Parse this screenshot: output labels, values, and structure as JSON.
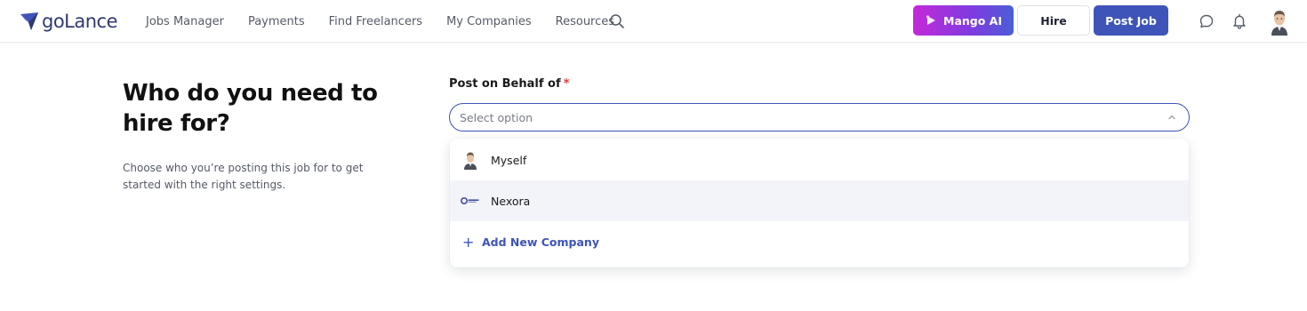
{
  "header": {
    "brand": "goLance",
    "nav": [
      {
        "label": "Jobs Manager"
      },
      {
        "label": "Payments"
      },
      {
        "label": "Find Freelancers"
      },
      {
        "label": "My Companies"
      },
      {
        "label": "Resources"
      }
    ],
    "mango_label": "Mango AI",
    "hire_label": "Hire",
    "post_job_label": "Post Job",
    "icons": [
      "search-icon",
      "chat-icon",
      "bell-icon",
      "avatar"
    ]
  },
  "intro": {
    "headline": "Who do you need to hire for?",
    "description": "Choose who you’re posting this job for to get started with the right settings."
  },
  "form": {
    "label": "Post on Behalf of",
    "required_mark": "*",
    "placeholder": "Select option",
    "options": [
      {
        "label": "Myself",
        "icon": "user-avatar"
      },
      {
        "label": "Nexora",
        "icon": "company-logo"
      }
    ],
    "add_new_label": "Add New Company"
  },
  "colors": {
    "primary": "#3f54b8",
    "mango_gradient_start": "#c22ad8",
    "mango_gradient_end": "#4a5fd6",
    "required": "#e5393b",
    "highlight_row": "#f2f4f9"
  }
}
